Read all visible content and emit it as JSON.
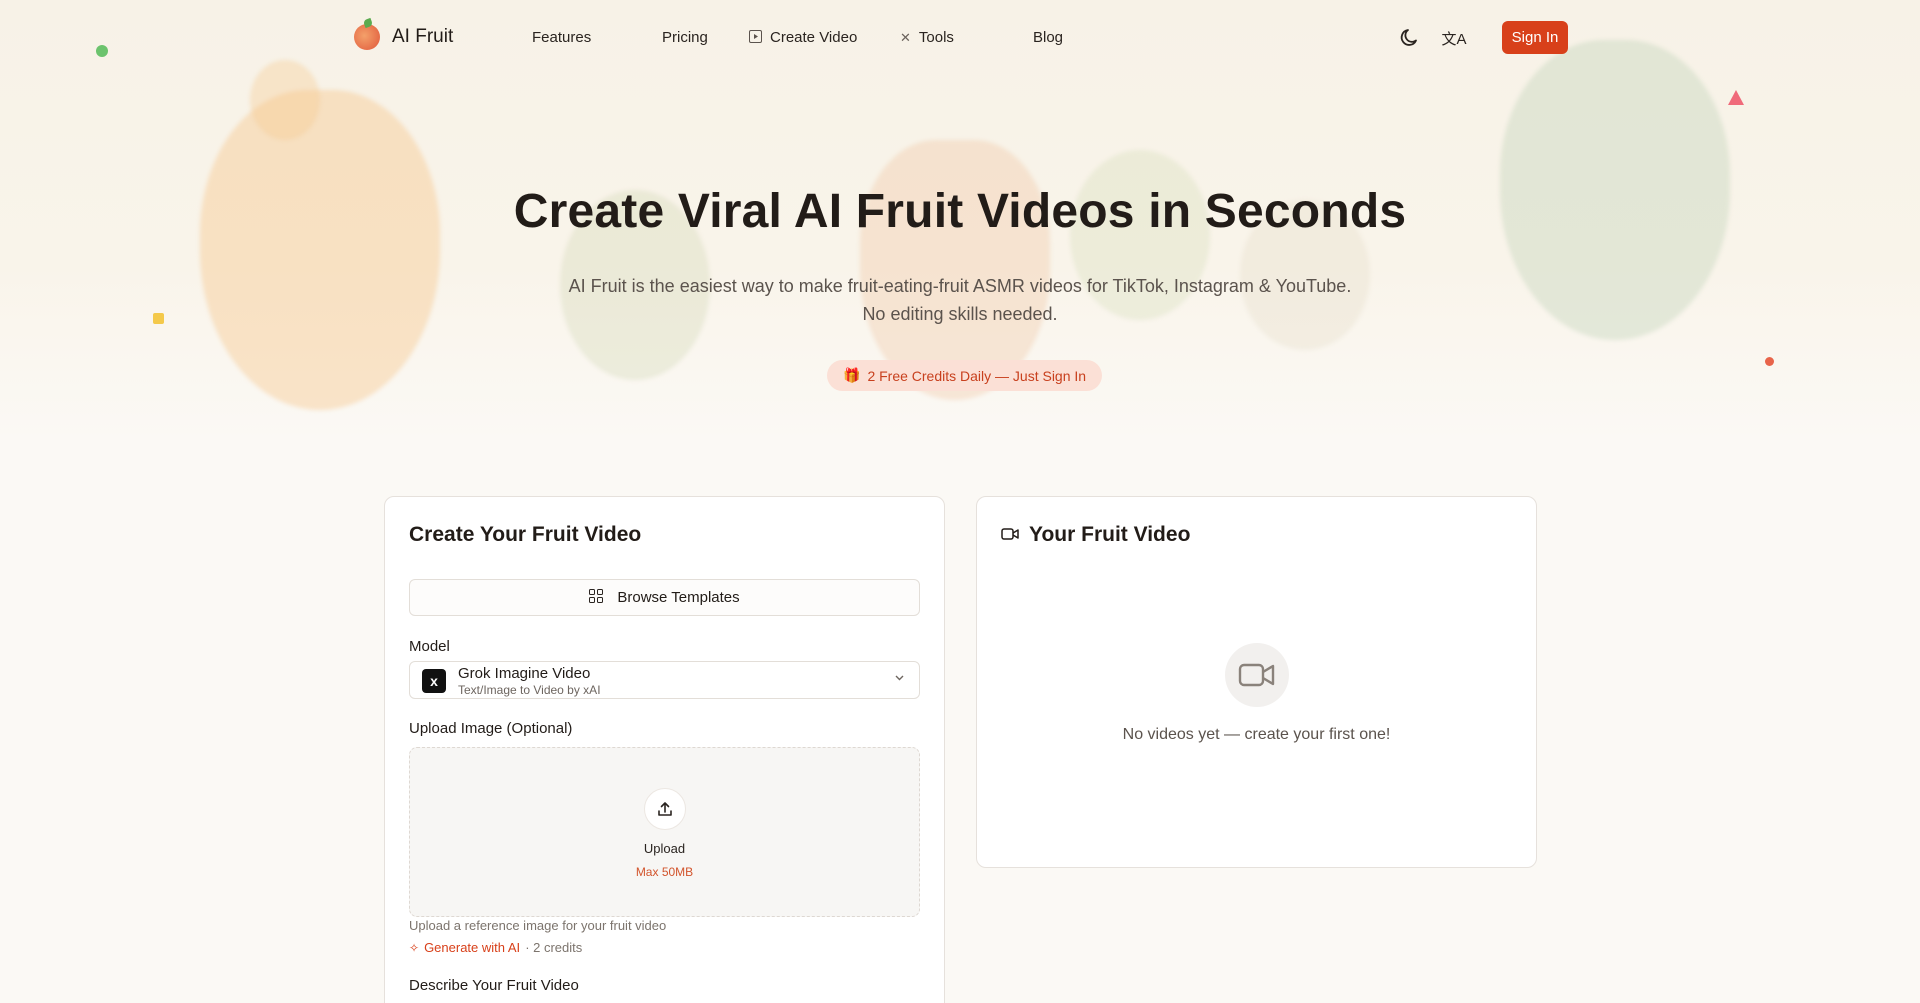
{
  "brand": {
    "name": "AI Fruit"
  },
  "nav": {
    "items": [
      {
        "label": "Features"
      },
      {
        "label": "Pricing"
      },
      {
        "label": "Create Video",
        "icon": "play-square-icon"
      },
      {
        "label": "Tools",
        "icon": "tools-icon"
      },
      {
        "label": "Blog"
      }
    ],
    "theme_icon": "moon-icon",
    "language_icon": "translate-icon",
    "signin_label": "Sign In"
  },
  "hero": {
    "title": "Create Viral AI Fruit Videos in Seconds",
    "subtitle_line1": "AI Fruit is the easiest way to make fruit-eating-fruit ASMR videos for TikTok, Instagram & YouTube.",
    "subtitle_line2": "No editing skills needed.",
    "badge": "2 Free Credits Daily — Just Sign In"
  },
  "create_card": {
    "title": "Create Your Fruit Video",
    "browse_label": "Browse Templates",
    "model_label": "Model",
    "model_name": "Grok Imagine Video",
    "model_desc": "Text/Image to Video by xAI",
    "upload_label": "Upload Image (Optional)",
    "upload_text": "Upload",
    "upload_max": "Max 50MB",
    "upload_help": "Upload a reference image for your fruit video",
    "generate_link": "Generate with AI",
    "generate_cost": "· 2 credits",
    "describe_label": "Describe Your Fruit Video"
  },
  "video_card": {
    "title": "Your Fruit Video",
    "empty_text": "No videos yet — create your first one!"
  },
  "colors": {
    "accent": "#d8401a",
    "badge_bg": "#fbe0d6"
  }
}
